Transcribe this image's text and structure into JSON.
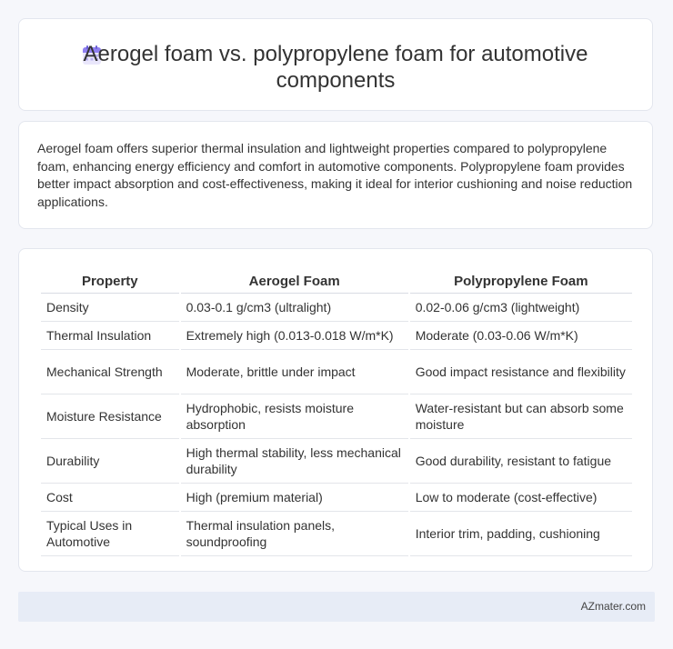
{
  "header": {
    "title": "Aerogel foam vs. polypropylene foam for automotive components",
    "icon": "calendar-icon"
  },
  "summary": {
    "text": "Aerogel foam offers superior thermal insulation and lightweight properties compared to polypropylene foam, enhancing energy efficiency and comfort in automotive components. Polypropylene foam provides better impact absorption and cost-effectiveness, making it ideal for interior cushioning and noise reduction applications."
  },
  "table": {
    "headers": [
      "Property",
      "Aerogel Foam",
      "Polypropylene Foam"
    ],
    "rows": [
      [
        "Density",
        "0.03-0.1 g/cm3 (ultralight)",
        "0.02-0.06 g/cm3 (lightweight)"
      ],
      [
        "Thermal Insulation",
        "Extremely high (0.013-0.018 W/m*K)",
        "Moderate (0.03-0.06 W/m*K)"
      ],
      [
        "Mechanical Strength",
        "Moderate, brittle under impact",
        "Good impact resistance and flexibility"
      ],
      [
        "Moisture Resistance",
        "Hydrophobic, resists moisture absorption",
        "Water-resistant but can absorb some moisture"
      ],
      [
        "Durability",
        "High thermal stability, less mechanical durability",
        "Good durability, resistant to fatigue"
      ],
      [
        "Cost",
        "High (premium material)",
        "Low to moderate (cost-effective)"
      ],
      [
        "Typical Uses in Automotive",
        "Thermal insulation panels, soundproofing",
        "Interior trim, padding, cushioning"
      ]
    ]
  },
  "footer": {
    "brand": "AZmater.com"
  },
  "colors": {
    "background": "#f6f7fb",
    "card": "#ffffff",
    "footer": "#e7ecf6",
    "icon_accent": "#7b6fe0"
  }
}
